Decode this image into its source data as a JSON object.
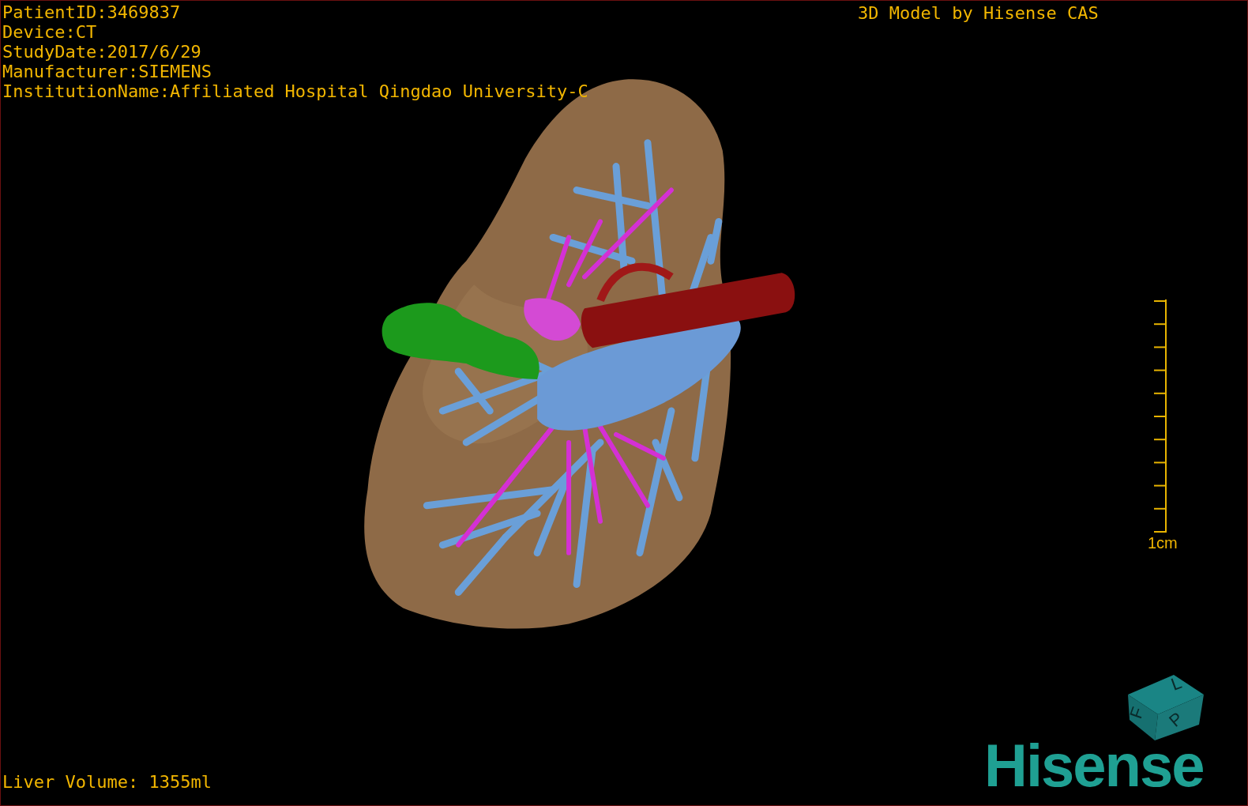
{
  "patient_info": [
    "PatientID:3469837",
    "Device:CT",
    "StudyDate:2017/6/29",
    "Manufacturer:SIEMENS",
    "InstitutionName:Affiliated Hospital Qingdao University-C"
  ],
  "model_credit": "3D Model by Hisense CAS",
  "scale_bar": {
    "label": "1cm"
  },
  "orientation_cube": {
    "faces": [
      "F",
      "L",
      "P"
    ]
  },
  "liver_volume": "Liver Volume: 1355ml",
  "logo": "Hisense"
}
